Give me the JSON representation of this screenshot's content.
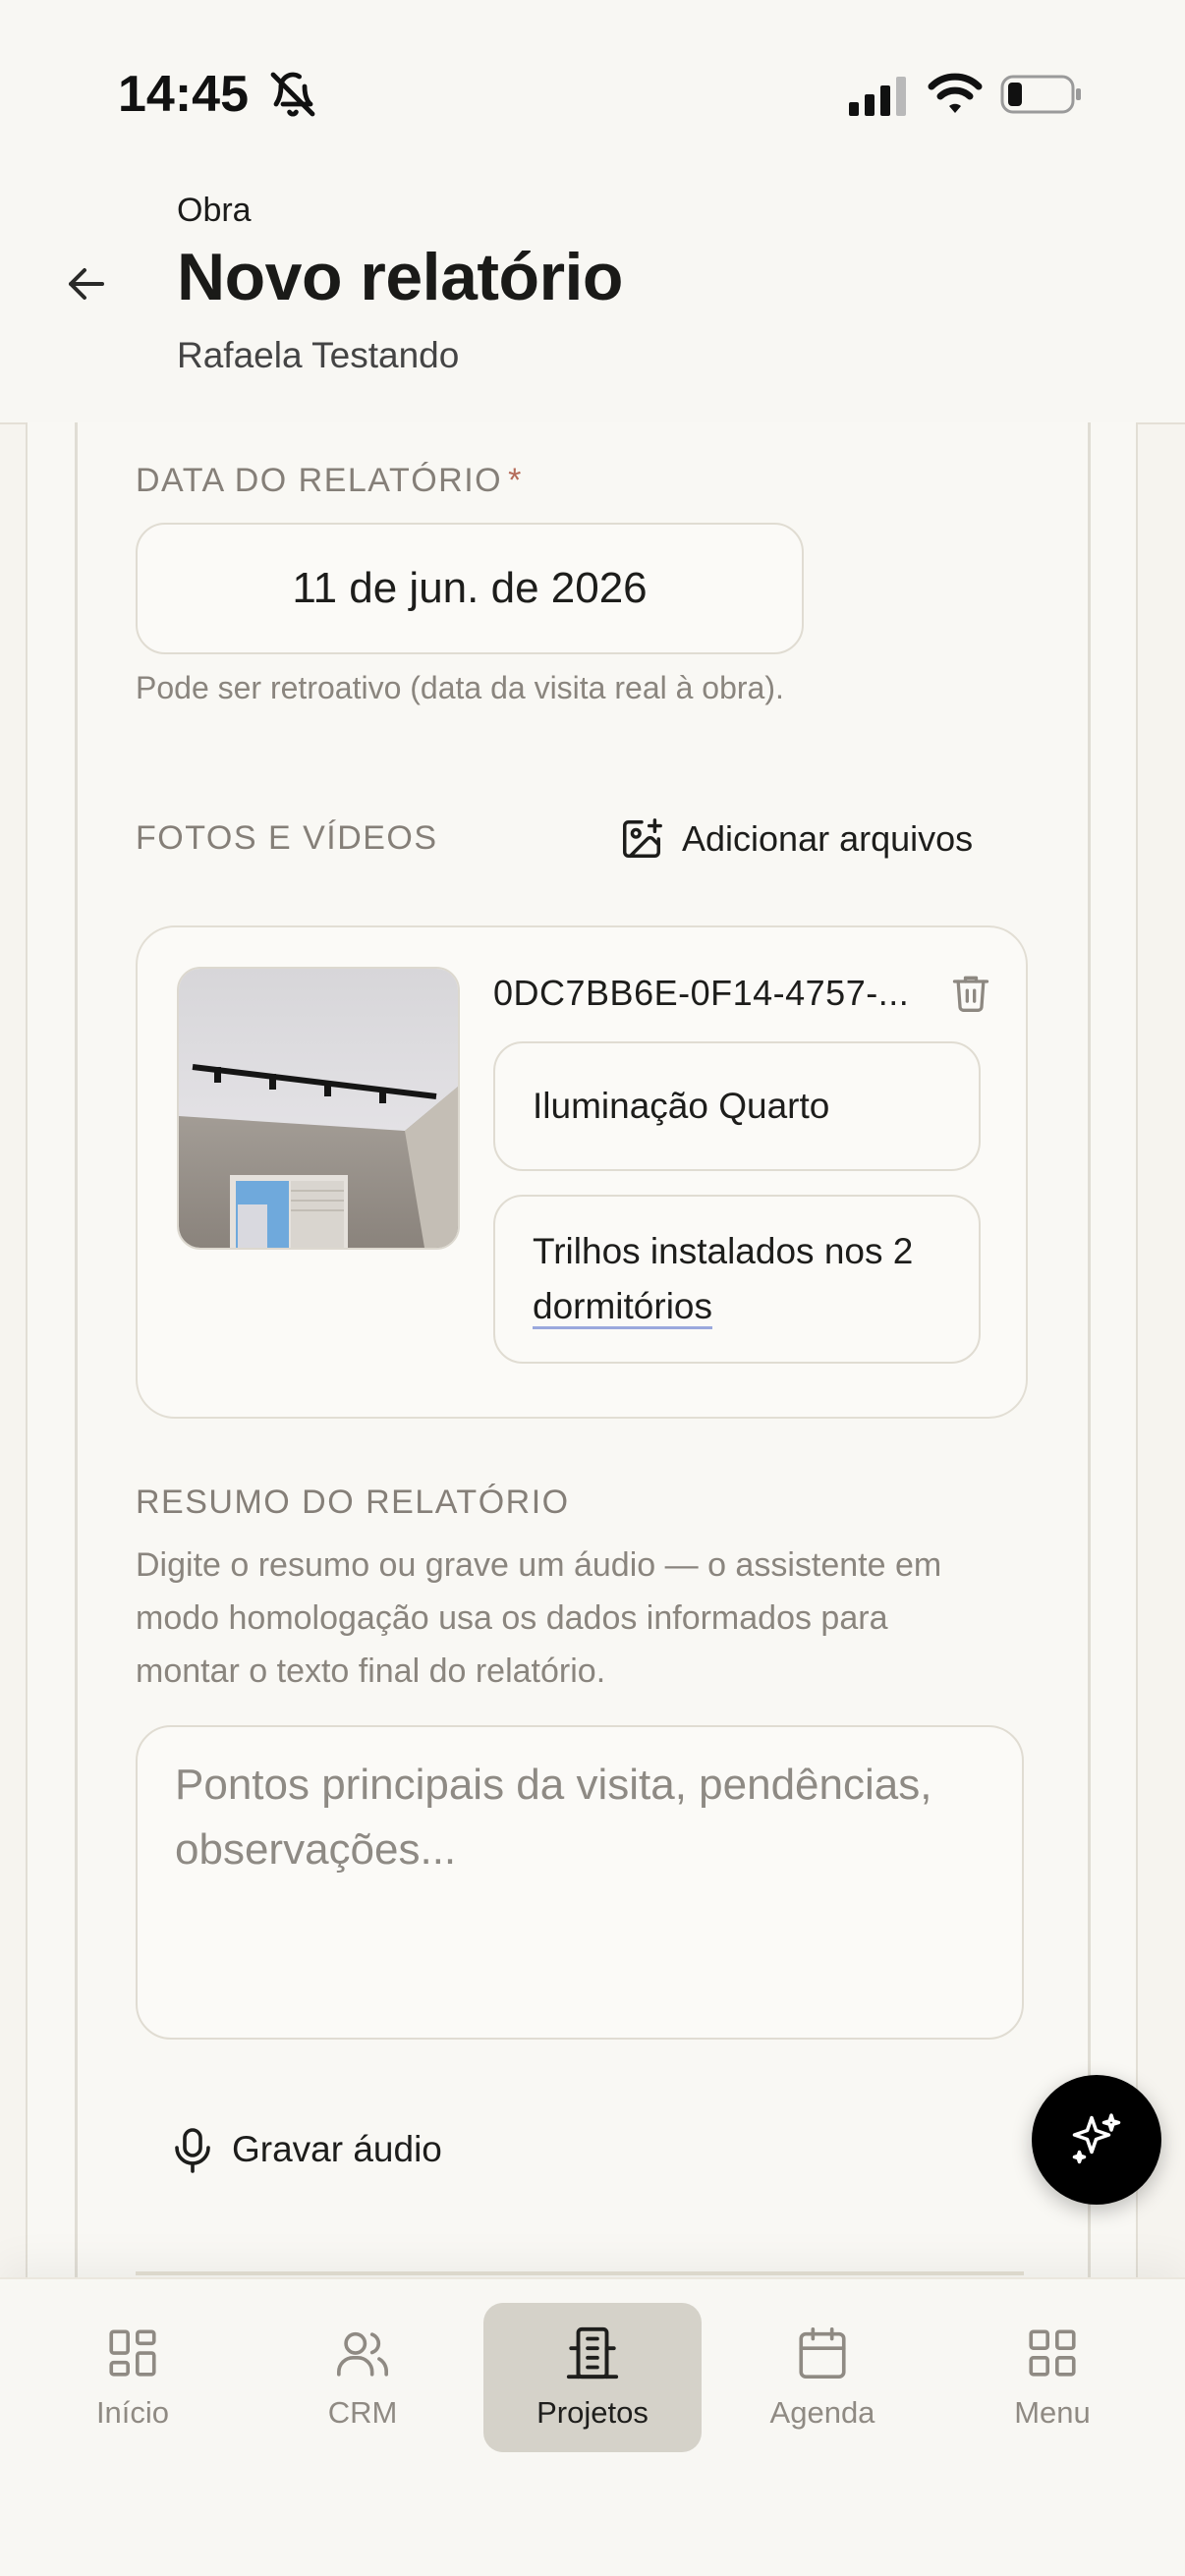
{
  "status_bar": {
    "time": "14:45"
  },
  "header": {
    "overline": "Obra",
    "title": "Novo relatório",
    "subtitle": "Rafaela Testando"
  },
  "report_date": {
    "label": "DATA DO RELATÓRIO",
    "required_mark": "*",
    "value": "11 de jun. de 2026",
    "helper": "Pode ser retroativo (data da visita real à obra)."
  },
  "media": {
    "label": "FOTOS E VÍDEOS",
    "add_button": "Adicionar arquivos",
    "items": [
      {
        "file_name": "0DC7BB6E-0F14-4757-...",
        "title": "Iluminação Quarto",
        "description_part1": "Trilhos instalados nos 2 ",
        "description_part2": "dormitórios"
      }
    ]
  },
  "summary": {
    "label": "RESUMO DO RELATÓRIO",
    "help": "Digite o resumo ou grave um áudio — o assistente em modo homologação usa os dados informados para montar o texto final do relatório.",
    "placeholder": "Pontos principais da visita, pendências, observações..."
  },
  "record_audio": {
    "label": "Gravar áudio"
  },
  "nav": {
    "items": [
      {
        "label": "Início",
        "icon": "grid-icon"
      },
      {
        "label": "CRM",
        "icon": "users-icon"
      },
      {
        "label": "Projetos",
        "icon": "building-icon"
      },
      {
        "label": "Agenda",
        "icon": "calendar-icon"
      },
      {
        "label": "Menu",
        "icon": "menu-grid-icon"
      }
    ],
    "active": "Projetos"
  },
  "colors": {
    "background": "#f6f4ef",
    "accent_active_tab": "#d5d2c9",
    "required": "#b56b5a",
    "fab": "#000000"
  }
}
